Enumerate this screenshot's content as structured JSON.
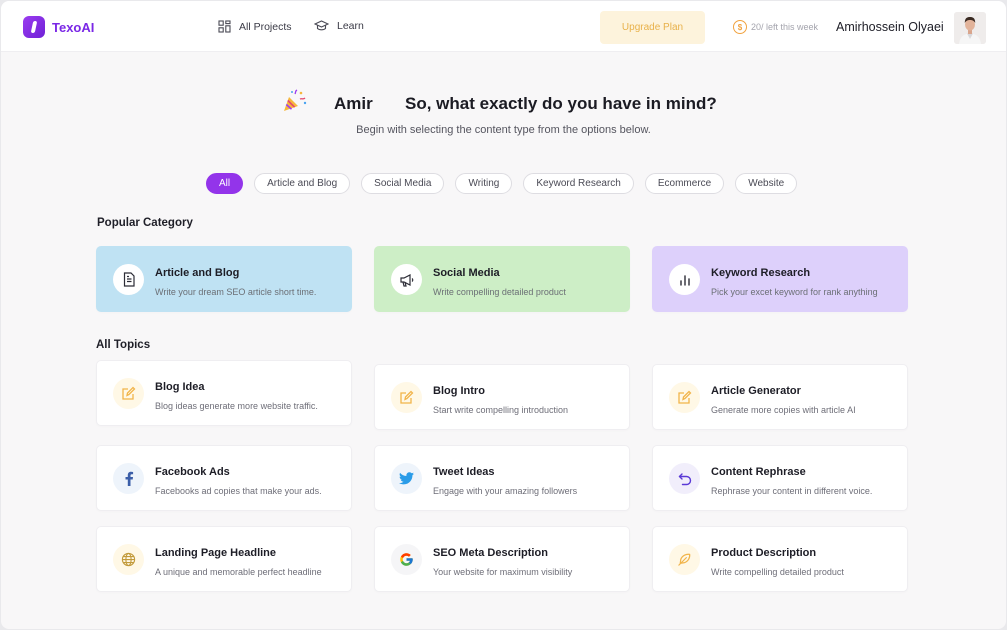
{
  "app": {
    "name": "TexoAI"
  },
  "nav": {
    "projects": "All Projects",
    "learn": "Learn"
  },
  "header": {
    "upgrade": "Upgrade Plan",
    "credits_count": "20",
    "credits_label": "/ left this week",
    "user_name": "Amirhossein Olyaei"
  },
  "greeting": {
    "name": "Amir",
    "question": "So, what exactly do you have in mind?",
    "subtitle": "Begin with selecting the content type from the options below."
  },
  "filters": [
    "All",
    "Article and  Blog",
    "Social Media",
    "Writing",
    "Keyword Research",
    "Ecommerce",
    "Website"
  ],
  "active_filter": "All",
  "popular": {
    "title": "Popular Category",
    "items": [
      {
        "title": "Article and Blog",
        "desc": "Write your dream SEO article short time.",
        "icon": "document-icon",
        "color": "#bfe2f3"
      },
      {
        "title": "Social Media",
        "desc": "Write compelling detailed product",
        "icon": "megaphone-icon",
        "color": "#cdeec6"
      },
      {
        "title": "Keyword Research",
        "desc": "Pick your excet keyword for rank anything",
        "icon": "bar-chart-icon",
        "color": "#ddd0fb"
      }
    ]
  },
  "topics": {
    "title": "All Topics",
    "items": [
      {
        "title": "Blog Idea",
        "desc": "Blog ideas generate more website traffic.",
        "icon": "edit-icon"
      },
      {
        "title": "Blog Intro",
        "desc": "Start write compelling introduction",
        "icon": "edit-icon"
      },
      {
        "title": "Article Generator",
        "desc": "Generate more copies with article AI",
        "icon": "edit-icon"
      },
      {
        "title": "Facebook Ads",
        "desc": "Facebooks ad copies that make your ads.",
        "icon": "facebook-icon"
      },
      {
        "title": "Tweet Ideas",
        "desc": "Engage with your amazing followers",
        "icon": "twitter-icon"
      },
      {
        "title": "Content Rephrase",
        "desc": "Rephrase your content in different voice.",
        "icon": "undo-arrow-icon"
      },
      {
        "title": "Landing Page Headline",
        "desc": "A unique and memorable perfect headline",
        "icon": "globe-icon"
      },
      {
        "title": "SEO Meta Description",
        "desc": "Your website for maximum visibility",
        "icon": "google-icon"
      },
      {
        "title": "Product Description",
        "desc": "Write compelling detailed product",
        "icon": "feather-icon"
      }
    ]
  },
  "colors": {
    "brand": "#9334ea",
    "accent_yellow": "#f1b44a"
  }
}
